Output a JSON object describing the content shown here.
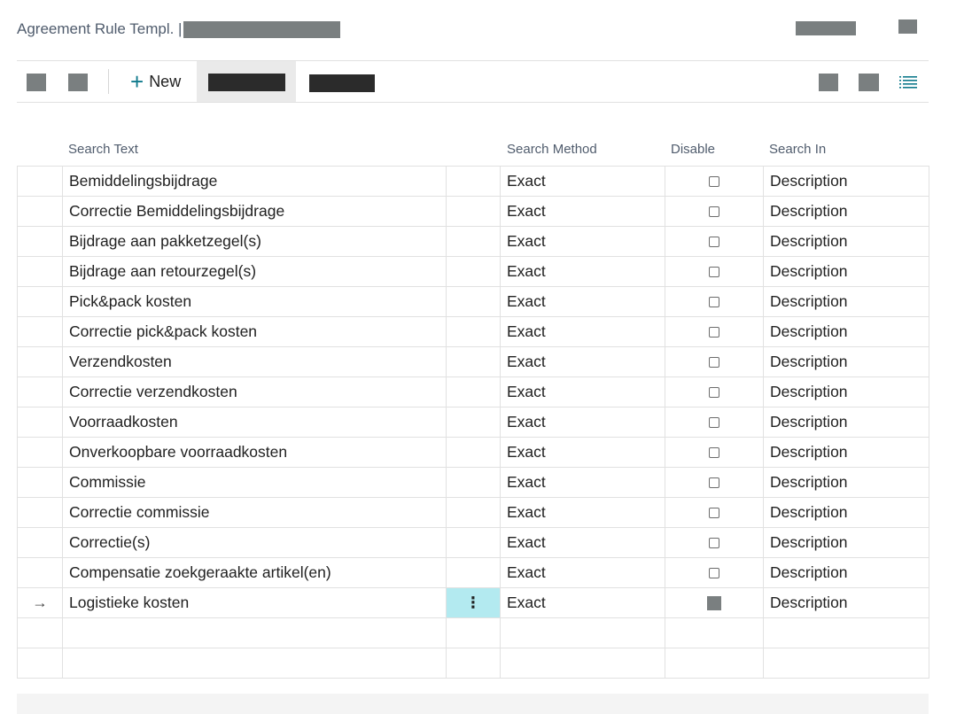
{
  "header": {
    "title": "Agreement Rule Templ. |"
  },
  "toolbar": {
    "new_label": "New",
    "new_icon": "plus-icon",
    "list_icon": "list-view-icon"
  },
  "columns": {
    "search_text": "Search Text",
    "search_method": "Search Method",
    "disable": "Disable",
    "search_in": "Search In"
  },
  "rows": [
    {
      "search_text": "Bemiddelingsbijdrage",
      "method": "Exact",
      "disabled": false,
      "search_in": "Description"
    },
    {
      "search_text": "Correctie Bemiddelingsbijdrage",
      "method": "Exact",
      "disabled": false,
      "search_in": "Description"
    },
    {
      "search_text": "Bijdrage aan pakketzegel(s)",
      "method": "Exact",
      "disabled": false,
      "search_in": "Description"
    },
    {
      "search_text": "Bijdrage aan retourzegel(s)",
      "method": "Exact",
      "disabled": false,
      "search_in": "Description"
    },
    {
      "search_text": "Pick&pack kosten",
      "method": "Exact",
      "disabled": false,
      "search_in": "Description"
    },
    {
      "search_text": "Correctie pick&pack kosten",
      "method": "Exact",
      "disabled": false,
      "search_in": "Description"
    },
    {
      "search_text": "Verzendkosten",
      "method": "Exact",
      "disabled": false,
      "search_in": "Description"
    },
    {
      "search_text": "Correctie verzendkosten",
      "method": "Exact",
      "disabled": false,
      "search_in": "Description"
    },
    {
      "search_text": "Voorraadkosten",
      "method": "Exact",
      "disabled": false,
      "search_in": "Description"
    },
    {
      "search_text": "Onverkoopbare voorraadkosten",
      "method": "Exact",
      "disabled": false,
      "search_in": "Description"
    },
    {
      "search_text": "Commissie",
      "method": "Exact",
      "disabled": false,
      "search_in": "Description"
    },
    {
      "search_text": "Correctie commissie",
      "method": "Exact",
      "disabled": false,
      "search_in": "Description"
    },
    {
      "search_text": "Correctie(s)",
      "method": "Exact",
      "disabled": false,
      "search_in": "Description"
    },
    {
      "search_text": "Compensatie zoekgeraakte artikel(en)",
      "method": "Exact",
      "disabled": false,
      "search_in": "Description"
    },
    {
      "search_text": "Logistieke kosten",
      "method": "Exact",
      "disabled": true,
      "search_in": "Description",
      "current": true,
      "indicator": "→",
      "menu": "⋮"
    },
    {
      "search_text": "",
      "method": "",
      "disabled": null,
      "search_in": ""
    },
    {
      "search_text": "",
      "method": "",
      "disabled": null,
      "search_in": ""
    }
  ],
  "colors": {
    "accent": "#0f7a8c",
    "selected_cell": "#b3eaf0",
    "redacted": "#7a7f80",
    "grid_border": "#e1e1e1"
  }
}
